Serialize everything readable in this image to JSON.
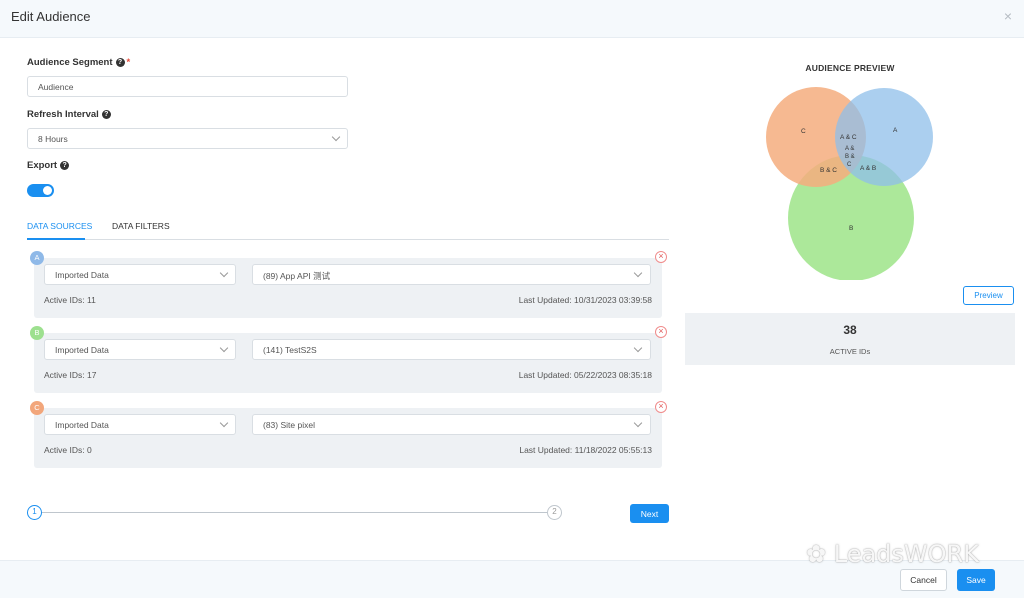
{
  "modal": {
    "title": "Edit Audience",
    "close": "×"
  },
  "form": {
    "segment_label": "Audience Segment",
    "required_mark": "*",
    "segment_value": "Audience",
    "refresh_label": "Refresh Interval",
    "refresh_value": "8 Hours",
    "export_label": "Export",
    "export_on": true
  },
  "tabs": [
    {
      "label": "DATA SOURCES",
      "active": true
    },
    {
      "label": "DATA FILTERS",
      "active": false
    }
  ],
  "sources": [
    {
      "badge": "A",
      "badge_color": "#8fb9e8",
      "type": "Imported Data",
      "source": "(89) App API 测试",
      "active_ids": "Active IDs: 11",
      "last_updated": "Last Updated: 10/31/2023 03:39:58"
    },
    {
      "badge": "B",
      "badge_color": "#9de08f",
      "type": "Imported Data",
      "source": "(141) TestS2S",
      "active_ids": "Active IDs: 17",
      "last_updated": "Last Updated: 05/22/2023 08:35:18"
    },
    {
      "badge": "C",
      "badge_color": "#f2a67b",
      "type": "Imported Data",
      "source": "(83) Site pixel",
      "active_ids": "Active IDs: 0",
      "last_updated": "Last Updated: 11/18/2022 05:55:13"
    }
  ],
  "stepper": {
    "step1": "1",
    "step2": "2",
    "next": "Next"
  },
  "preview": {
    "title": "AUDIENCE PREVIEW",
    "labels": {
      "a": "A",
      "b": "B",
      "c": "C",
      "ac": "A & C",
      "abc_1": "A &",
      "abc_2": "B &",
      "abc_3": "C",
      "bc": "B & C",
      "ab": "A & B"
    },
    "button": "Preview",
    "count": "38",
    "count_label": "ACTIVE IDs"
  },
  "footer": {
    "cancel": "Cancel",
    "save": "Save"
  },
  "watermark": "LeadsWORK",
  "colors": {
    "accent": "#1a8ff0",
    "set_a": "#8fbfea",
    "set_b": "#a3e58f",
    "set_c": "#f4ad7e",
    "remove": "#e05a5a"
  }
}
